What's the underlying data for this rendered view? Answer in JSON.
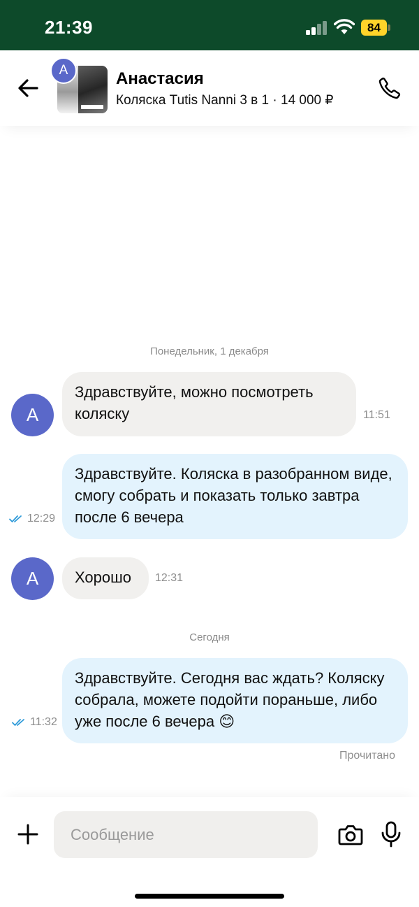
{
  "status_bar": {
    "time": "21:39",
    "battery": "84"
  },
  "header": {
    "avatar_letter": "А",
    "name": "Анастасия",
    "listing": "Коляска Tutis Nanni 3 в 1 · 14 000 ₽"
  },
  "chat": {
    "date_monday": "Понедельник, 1 декабря",
    "date_today": "Сегодня",
    "messages": [
      {
        "direction": "in",
        "avatar": "А",
        "text": "Здравствуйте, можно посмотреть коляску",
        "time": "11:51"
      },
      {
        "direction": "out",
        "text": "Здравствуйте. Коляска в разобранном виде, смогу собрать и показать только завтра после 6 вечера",
        "time": "12:29"
      },
      {
        "direction": "in",
        "avatar": "А",
        "text": "Хорошо",
        "time": "12:31"
      },
      {
        "direction": "out",
        "text": "Здравствуйте. Сегодня вас ждать? Коляску собрала, можете подойти пораньше, либо уже после 6 вечера 😊",
        "time": "11:32"
      }
    ],
    "read_status": "Прочитано"
  },
  "composer": {
    "placeholder": "Сообщение"
  },
  "colors": {
    "status_bar_bg": "#0d4a2a",
    "avatar": "#5a68c9",
    "incoming_bubble": "#f1f0ee",
    "outgoing_bubble": "#e3f3fd",
    "read_ticks": "#2f9bd9",
    "battery": "#ffd42a"
  },
  "icons": [
    "back-arrow-icon",
    "phone-icon",
    "plus-icon",
    "camera-icon",
    "microphone-icon",
    "double-check-icon",
    "signal-icon",
    "wifi-icon",
    "battery-icon"
  ]
}
